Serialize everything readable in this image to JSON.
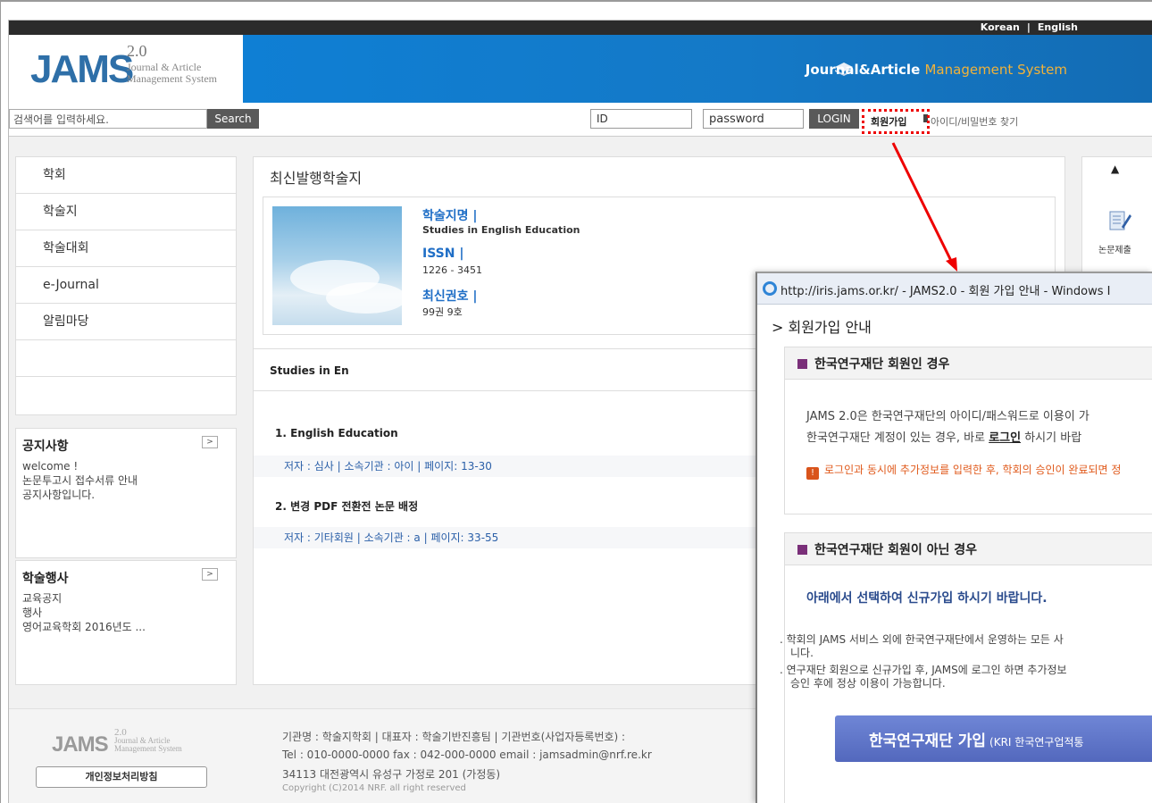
{
  "header": {
    "lang_korean": "Korean",
    "lang_sep": "|",
    "lang_english": "English",
    "logo_text": "JAMS",
    "logo_version": "2.0",
    "logo_sub1": "Journal & Article",
    "logo_sub2": "Management System",
    "banner_title_bold": "Journal&Article",
    "banner_title_accent": "Management System"
  },
  "searchbar": {
    "search_placeholder": "검색어를 입력하세요.",
    "search_button": "Search",
    "id_placeholder": "ID",
    "password_placeholder": "password",
    "login_button": "LOGIN",
    "join_link": "회원가입",
    "find_link": "아이디/비밀번호 찾기"
  },
  "sidebar": {
    "items": [
      {
        "label": "학회"
      },
      {
        "label": "학술지"
      },
      {
        "label": "학술대회"
      },
      {
        "label": "e-Journal"
      },
      {
        "label": "알림마당"
      }
    ],
    "notice": {
      "title": "공지사항",
      "more": ">",
      "lines": [
        "welcome !",
        "논문투고시 접수서류 안내",
        "공지사항입니다."
      ]
    },
    "events": {
      "title": "학술행사",
      "more": ">",
      "lines": [
        "교육공지",
        "행사",
        "영어교육학회 2016년도 ..."
      ]
    }
  },
  "main": {
    "title": "최신발행학술지",
    "journal": {
      "name_label": "학술지명 |",
      "name_value": "Studies in English Education",
      "issn_label": "ISSN |",
      "issn_value": "1226 - 3451",
      "latest_label": "최신권호 |",
      "latest_value": "99권 9호"
    },
    "list_header": "Studies in En",
    "articles": [
      {
        "title": "1. English Education",
        "meta": "저자 : 심사 | 소속기관 : 아이 | 페이지: 13-30"
      },
      {
        "title": "2. 변경 PDF 전환전 논문 배정",
        "meta": "저자 : 기타회원 | 소속기관 : a | 페이지: 33-55"
      }
    ]
  },
  "quickbar": {
    "up": "▲",
    "submit_label": "논문제출"
  },
  "footer": {
    "logo": "JAMS",
    "logo_version": "2.0",
    "logo_sub1": "Journal & Article",
    "logo_sub2": "Management System",
    "privacy_button": "개인정보처리방침",
    "line1": "기관명 : 학술지학회 | 대표자 : 학술기반진흥팀 | 기관번호(사업자등록번호) :",
    "line2": "Tel : 010-0000-0000 fax : 042-000-0000 email : jamsadmin@nrf.re.kr",
    "line3": "34113 대전광역시 유성구 가정로 201 (가정동)",
    "copyright": "Copyright (C)2014 NRF. all right reserved"
  },
  "popup": {
    "window_title": "http://iris.jams.or.kr/ - JAMS2.0 - 회원 가입 안내 - Windows I",
    "heading": "> 회원가입 안내",
    "section1": {
      "title": "한국연구재단 회원인 경우",
      "line1": "JAMS 2.0은 한국연구재단의 아이디/패스워드로 이용이 가",
      "line2_a": "한국연구재단 계정이 있는 경우, 바로 ",
      "line2_link": "로그인",
      "line2_b": " 하시기 바랍",
      "warning": "로그인과 동시에 추가정보를 입력한 후, 학회의 승인이 완료되면 정"
    },
    "section2": {
      "title": "한국연구재단 회원이 아닌 경우",
      "subtitle": "아래에서 선택하여 신규가입 하시기 바랍니다.",
      "bullet1a": ". 학회의 JAMS 서비스 외에 한국연구재단에서 운영하는 모든 사",
      "bullet1b": "니다.",
      "bullet2a": ". 연구재단 회원으로 신규가입 후, JAMS에 로그인 하면 추가정보",
      "bullet2b": "승인 후에 정상 이용이 가능합니다.",
      "kri_button": "한국연구재단 가입",
      "kri_small": "(KRI 한국연구업적통"
    }
  },
  "colors": {
    "banner": "#1479c7",
    "accent": "#f0b23a",
    "link": "#1f6ec6",
    "highlight": "#e00000",
    "kri_button": "#5b70c6"
  }
}
